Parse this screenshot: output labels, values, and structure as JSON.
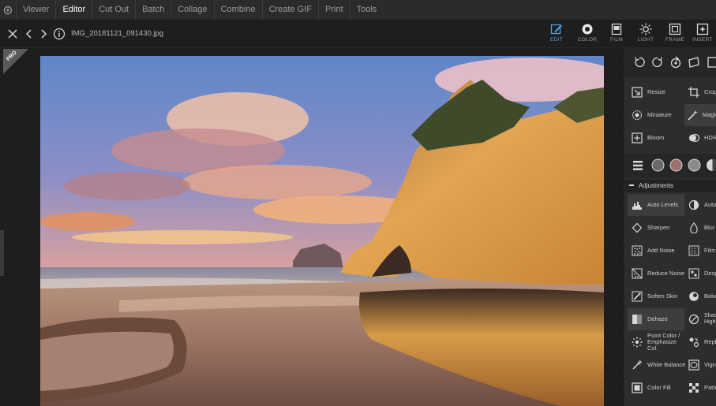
{
  "menubar": {
    "items": [
      "Viewer",
      "Editor",
      "Cut Out",
      "Batch",
      "Collage",
      "Combine",
      "Create GIF",
      "Print",
      "Tools"
    ],
    "active": "Editor"
  },
  "toolbar": {
    "filename": "IMG_20181121_091430.jpg",
    "modes": [
      {
        "label": "EDIT",
        "icon": "edit-icon"
      },
      {
        "label": "COLOR",
        "icon": "color-icon"
      },
      {
        "label": "FILM",
        "icon": "film-icon"
      },
      {
        "label": "LIGHT",
        "icon": "light-icon"
      },
      {
        "label": "FRAME",
        "icon": "frame-icon"
      },
      {
        "label": "INSERT",
        "icon": "insert-icon"
      }
    ],
    "active_mode": "EDIT"
  },
  "badge": "PRO",
  "panel": {
    "tools_top": [
      {
        "label": "Resize",
        "icon": "resize-icon"
      },
      {
        "label": "Crop",
        "icon": "crop-icon"
      },
      {
        "label": "Miniature",
        "icon": "miniature-icon"
      },
      {
        "label": "Magic",
        "icon": "magic-wand-icon"
      },
      {
        "label": "Bloom",
        "icon": "bloom-icon"
      },
      {
        "label": "HDR",
        "icon": "hdr-icon"
      }
    ],
    "adjustments_title": "Adjustments",
    "adjustments": [
      {
        "label": "Auto Levels",
        "icon": "auto-levels-icon"
      },
      {
        "label": "Auto C",
        "icon": "auto-contrast-icon"
      },
      {
        "label": "Sharpen",
        "icon": "sharpen-icon"
      },
      {
        "label": "Blur",
        "icon": "blur-icon"
      },
      {
        "label": "Add Noise",
        "icon": "add-noise-icon"
      },
      {
        "label": "Film G",
        "icon": "film-grain-icon"
      },
      {
        "label": "Reduce Noise",
        "icon": "reduce-noise-icon"
      },
      {
        "label": "Despe",
        "icon": "despeckle-icon"
      },
      {
        "label": "Soften Skin",
        "icon": "soften-skin-icon"
      },
      {
        "label": "Bokeh",
        "icon": "bokeh-icon"
      },
      {
        "label": "Dehaze",
        "icon": "dehaze-icon"
      },
      {
        "label": "Shado Highli",
        "icon": "shadow-highlight-icon"
      },
      {
        "label": "Point Color / Emphasize Col.",
        "icon": "point-color-icon"
      },
      {
        "label": "Repla",
        "icon": "replace-color-icon"
      },
      {
        "label": "White Balance",
        "icon": "white-balance-icon"
      },
      {
        "label": "Vigne",
        "icon": "vignette-icon"
      },
      {
        "label": "Color Fill",
        "icon": "color-fill-icon"
      },
      {
        "label": "Patter",
        "icon": "pattern-icon"
      }
    ],
    "colors": {
      "accent": "#4ba3e3",
      "panel": "#2d2d2d",
      "highlight": "#3d3d3d"
    }
  }
}
